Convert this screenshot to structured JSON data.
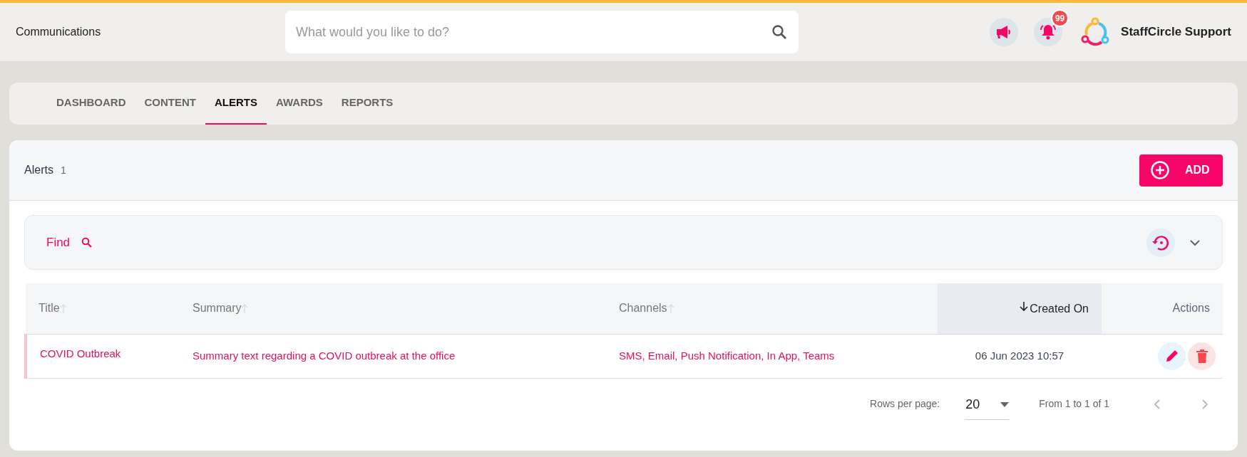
{
  "header": {
    "page_title": "Communications",
    "search": {
      "placeholder": "What would you like to do?"
    },
    "notification_count": "99",
    "user_name": "StaffCircle Support"
  },
  "tabs": [
    {
      "label": "DASHBOARD",
      "selected": false
    },
    {
      "label": "CONTENT",
      "selected": false
    },
    {
      "label": "ALERTS",
      "selected": true
    },
    {
      "label": "AWARDS",
      "selected": false
    },
    {
      "label": "REPORTS",
      "selected": false
    }
  ],
  "panel": {
    "title": "Alerts",
    "count": "1",
    "add_button": "ADD",
    "find_label": "Find"
  },
  "table": {
    "columns": [
      {
        "label": "Title",
        "kind": "sortable"
      },
      {
        "label": "Summary",
        "kind": "sortable"
      },
      {
        "label": "Channels",
        "kind": "sortable"
      },
      {
        "label": "Created On",
        "kind": "sorted"
      },
      {
        "label": "Actions",
        "kind": "plain"
      }
    ],
    "rows": [
      {
        "title": "COVID Outbreak",
        "summary": "Summary text regarding a COVID outbreak at the office",
        "channels": "SMS, Email, Push Notification, In App, Teams",
        "created_on": "06 Jun 2023 10:57"
      }
    ]
  },
  "pagination": {
    "rows_per_page_label": "Rows per page:",
    "rows_per_page": "20",
    "range": "From 1 to 1 of 1"
  }
}
